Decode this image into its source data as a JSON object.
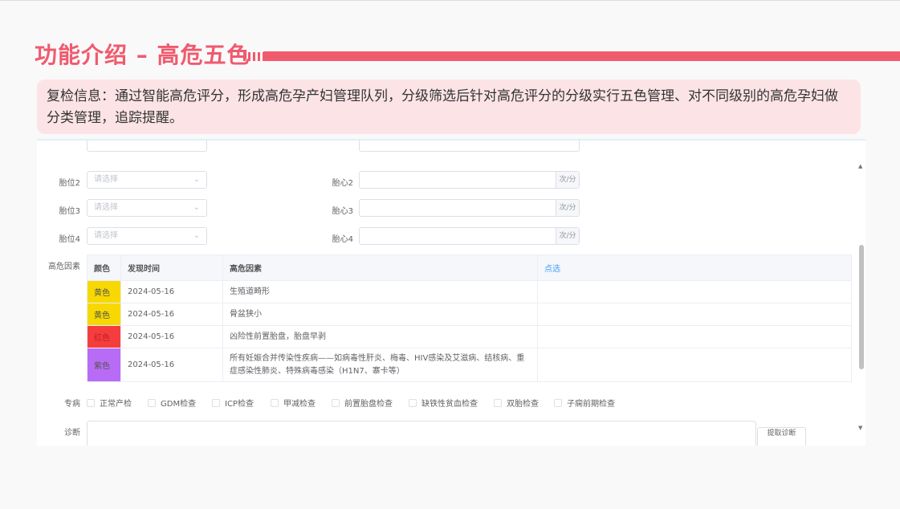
{
  "title": "功能介绍 – 高危五色",
  "info": "复检信息：通过智能高危评分，形成高危孕产妇管理队列，分级筛选后针对高危评分的分级实行五色管理、对不同级别的高危孕妇做分类管理，追踪提醒。",
  "accent": "#f05a6d",
  "form": {
    "rows": [
      {
        "label": "胎位2",
        "placeholder": "请选择",
        "hr_label": "胎心2",
        "unit": "次/分"
      },
      {
        "label": "胎位3",
        "placeholder": "请选择",
        "hr_label": "胎心3",
        "unit": "次/分"
      },
      {
        "label": "胎位4",
        "placeholder": "请选择",
        "hr_label": "胎心4",
        "unit": "次/分"
      }
    ],
    "risk_label": "高危因素",
    "table": {
      "headers": [
        "颜色",
        "发现时间",
        "高危因素",
        "点选"
      ],
      "rows": [
        {
          "color": "黄色",
          "hex": "#f7d800",
          "date": "2024-05-16",
          "factor": "生殖道畸形"
        },
        {
          "color": "黄色",
          "hex": "#f7d800",
          "date": "2024-05-16",
          "factor": "骨盆狭小"
        },
        {
          "color": "红色",
          "hex": "#f53d3d",
          "date": "2024-05-16",
          "factor": "凶险性前置胎盘，胎盘早剥"
        },
        {
          "color": "紫色",
          "hex": "#b86cf5",
          "date": "2024-05-16",
          "factor": "所有妊娠合并传染性疾病——如病毒性肝炎、梅毒、HIV感染及艾滋病、结核病、重症感染性肺炎、特殊病毒感染（H1N7、寨卡等）"
        }
      ]
    },
    "special_label": "专病",
    "special": [
      "正常产检",
      "GDM检查",
      "ICP检查",
      "甲减检查",
      "前置胎盘检查",
      "缺铁性贫血检查",
      "双胎检查",
      "子痫前期检查"
    ],
    "diagnosis_label": "诊断",
    "diagnosis_button": "提取诊断"
  }
}
